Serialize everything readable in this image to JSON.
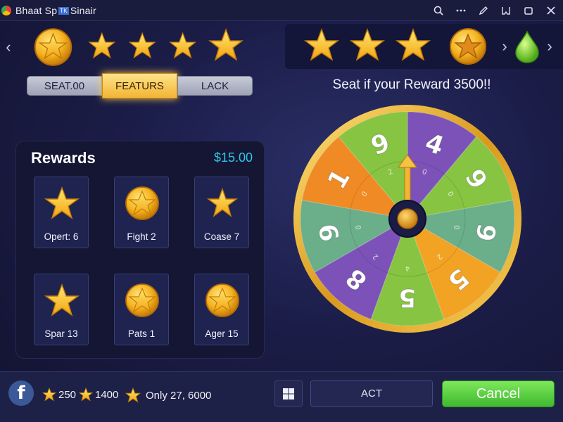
{
  "window": {
    "title_part1": "Bhaat Sp",
    "title_badge": "TK",
    "title_part2": "Sinair",
    "icons": [
      "search-icon",
      "more-icon",
      "pen-icon",
      "bookmark-icon",
      "restore-icon",
      "close-icon"
    ]
  },
  "tabs": [
    {
      "label": "SEAT.00",
      "active": false
    },
    {
      "label": "FEATURS",
      "active": true
    },
    {
      "label": "LACK",
      "active": false
    }
  ],
  "wheel": {
    "caption": "Seat if your Reward 3500!!",
    "segments": [
      {
        "number": "4",
        "color": "#7c52b8"
      },
      {
        "number": "9",
        "color": "#86c442"
      },
      {
        "number": "9",
        "color": "#6aae8a"
      },
      {
        "number": "5",
        "color": "#f2a324"
      },
      {
        "number": "5",
        "color": "#86c442"
      },
      {
        "number": "8",
        "color": "#7c52b8"
      },
      {
        "number": "9",
        "color": "#6aae8a"
      },
      {
        "number": "1",
        "color": "#f08a24"
      },
      {
        "number": "9",
        "color": "#86c442"
      }
    ],
    "small_marks": [
      "0",
      "0",
      "0",
      "2",
      "4",
      "2",
      "0",
      "0",
      "2"
    ]
  },
  "rewards": {
    "title": "Rewards",
    "amount": "$15.00",
    "items": [
      {
        "label": "Opert: 6",
        "icon": "star-icon"
      },
      {
        "label": "Fight 2",
        "icon": "star-coin-icon"
      },
      {
        "label": "Coase 7",
        "icon": "star-icon"
      },
      {
        "label": "Spar 13",
        "icon": "star-icon"
      },
      {
        "label": "Pats 1",
        "icon": "star-coin-icon"
      },
      {
        "label": "Ager 15",
        "icon": "star-coin-icon"
      }
    ]
  },
  "bottom": {
    "stat1": "250",
    "stat2": "1400",
    "stat3": "Only 27, 6000",
    "act_label": "ACT",
    "cancel_label": "Cancel"
  },
  "colors": {
    "accent_gold": "#f2b534",
    "amount_cyan": "#2fc7e8",
    "cancel_green": "#4cc13a"
  }
}
